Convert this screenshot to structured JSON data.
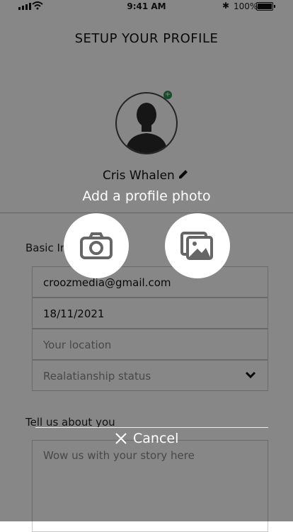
{
  "status_bar": {
    "time": "9:41 AM",
    "battery_text": "100%"
  },
  "header": {
    "title": "SETUP YOUR PROFILE",
    "user_name": "Cris Whalen"
  },
  "basic_info": {
    "label": "Basic In",
    "email": "croozmedia@gmail.com",
    "dob": "18/11/2021",
    "location_placeholder": "Your location",
    "relationship_placeholder": "Realatianship status"
  },
  "about": {
    "label": "Tell us about you",
    "placeholder": "Wow us with your story here"
  },
  "overlay": {
    "add_photo_label": "Add a profile photo",
    "cancel_label": "Cancel"
  },
  "icons": [
    "signal-icon",
    "wifi-icon",
    "bluetooth-icon",
    "battery-icon",
    "avatar-silhouette-icon",
    "add-badge-icon",
    "pencil-icon",
    "chevron-down-icon",
    "camera-icon",
    "gallery-icon",
    "close-icon"
  ],
  "colors": {
    "overlay": "#000000",
    "badge": "#2f8f4f"
  }
}
